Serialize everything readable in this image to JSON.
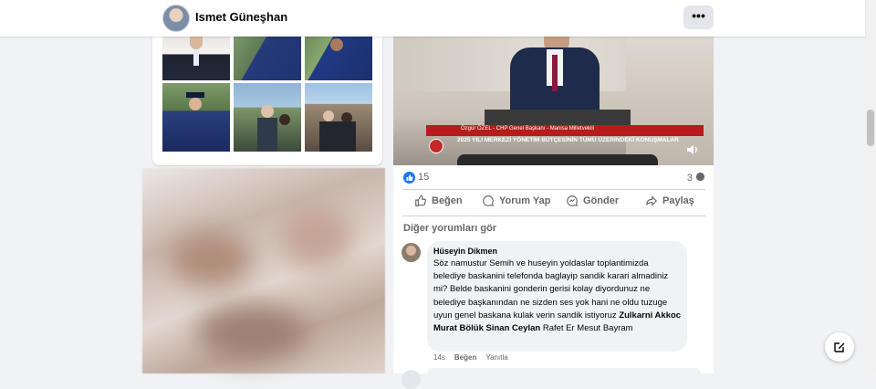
{
  "header": {
    "profile_name": "Ismet Güneşhan",
    "more_label": "•••"
  },
  "photos_grid": {
    "items": [
      {
        "desc": "man-in-suit"
      },
      {
        "desc": "graduate-gown"
      },
      {
        "desc": "graduate-gown-2"
      },
      {
        "desc": "graduate-cap"
      },
      {
        "desc": "couple-outdoor"
      },
      {
        "desc": "couple-monument"
      }
    ]
  },
  "post": {
    "video_caption_line1": "Özgür ÖZEL - CHP Genel Başkanı - Manisa Milletvekili",
    "video_caption_line2": "2025 YILI MERKEZİ YÖNETİM BÜTÇESİNİN TÜMÜ ÜZERİNDEKİ KONUŞMALAR",
    "like_count": "15",
    "comment_count": "3",
    "actions": {
      "like": "Beğen",
      "comment": "Yorum Yap",
      "send": "Gönder",
      "share": "Paylaş"
    },
    "more_comments_label": "Diğer yorumları gör"
  },
  "comment": {
    "author": "Hüseyin Dikmen",
    "text_part1": "Söz namustur Semih ve huseyin yoldaslar toplantimizda belediye baskanini telefonda baglayip sandik karari almadiniz mi? Belde baskanini gonderin gerisi kolay diyordunuz ne belediye başkanından ne sizden ses yok hani ne oldu tuzuge uyun genel baskana kulak verin sandik istiyoruz ",
    "mentions": "Zulkarni Akkoc Murat Bölük Sinan Ceylan",
    "text_part2": " Rafet Er Mesut Bayram",
    "time": "14s",
    "like": "Beğen",
    "reply": "Yanıtla"
  },
  "colors": {
    "accent": "#1877f2",
    "background": "#f0f2f5",
    "caption_red": "#b71c1c"
  },
  "icons": [
    "more-icon",
    "like-icon",
    "comment-icon",
    "send-icon",
    "share-icon",
    "volume-icon",
    "compose-icon"
  ]
}
